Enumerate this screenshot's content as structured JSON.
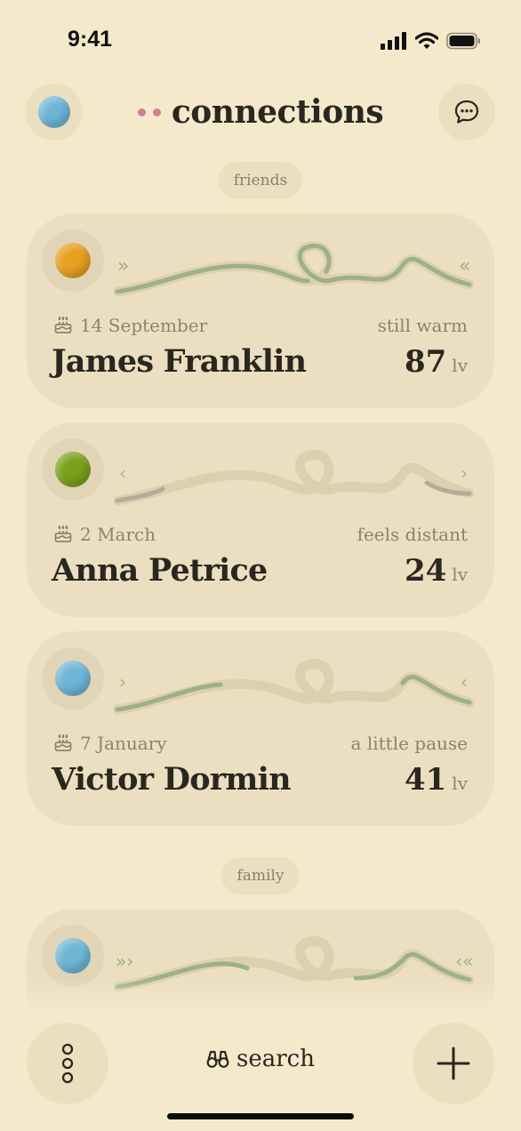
{
  "status_bar": {
    "time": "9:41"
  },
  "header": {
    "title": "connections"
  },
  "sections": [
    {
      "label": "friends"
    },
    {
      "label": "family"
    }
  ],
  "cards": [
    {
      "name": "James Franklin",
      "birthday": "14 September",
      "status": "still warm",
      "level": "87",
      "level_unit": "lv",
      "ball_color": "#e7a01f"
    },
    {
      "name": "Anna Petrice",
      "birthday": "2 March",
      "status": "feels distant",
      "level": "24",
      "level_unit": "lv",
      "ball_color": "#7aa01b"
    },
    {
      "name": "Victor Dormin",
      "birthday": "7 January",
      "status": "a little pause",
      "level": "41",
      "level_unit": "lv",
      "ball_color": "#6db6d6"
    }
  ],
  "bottom_bar": {
    "search_label": "search"
  },
  "colors": {
    "background": "#f5e9cc",
    "card": "#ecdfc1",
    "accent_green": "#9cb282",
    "accent_pink": "#d07f95"
  }
}
